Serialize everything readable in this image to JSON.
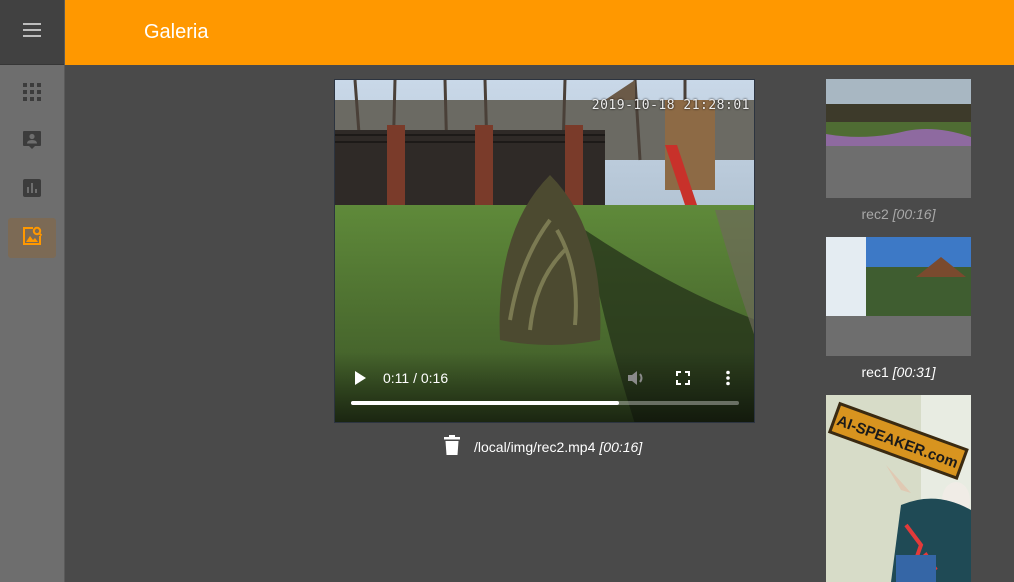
{
  "header": {
    "title": "Galeria"
  },
  "sidebar": {
    "items": [
      {
        "icon": "menu-icon"
      },
      {
        "icon": "apps-grid-icon"
      },
      {
        "icon": "contact-icon"
      },
      {
        "icon": "chart-icon"
      },
      {
        "icon": "gallery-icon",
        "active": true
      }
    ],
    "accent": "#ff9800"
  },
  "player": {
    "stamp": "2019-10-18 21:28:01",
    "time": "0:11 / 0:16",
    "progress": 0.69
  },
  "current_file": {
    "path": "/local/img/rec2.mp4",
    "duration": "[00:16]"
  },
  "thumbnails": [
    {
      "name": "rec2",
      "duration": "[00:16]"
    },
    {
      "name": "rec1",
      "duration": "[00:31]"
    },
    {
      "sign": "AI-SPEAKER.com"
    }
  ]
}
